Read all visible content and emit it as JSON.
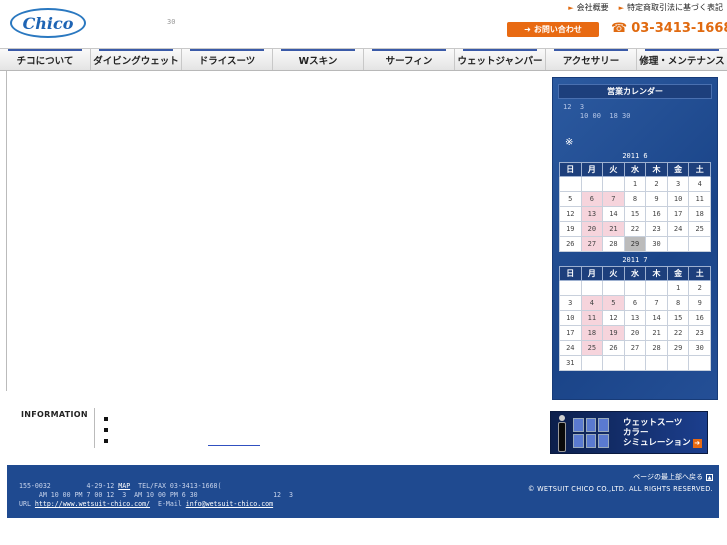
{
  "header": {
    "logo_text": "Chico",
    "logo_tagline": "30",
    "links": [
      {
        "label": "会社概要"
      },
      {
        "label": "特定商取引法に基づく表記"
      }
    ],
    "contact_label": "お問い合わせ",
    "phone": "03-3413-1668"
  },
  "nav": {
    "items": [
      {
        "label": "チコについて"
      },
      {
        "label": "ダイビングウェット"
      },
      {
        "label": "ドライスーツ"
      },
      {
        "label": "Wスキン"
      },
      {
        "label": "サーフィン"
      },
      {
        "label": "ウェットジャンパー"
      },
      {
        "label": "アクセサリー"
      },
      {
        "label": "修理・メンテナンス"
      }
    ]
  },
  "sidebar": {
    "title": "営業カレンダー",
    "note_line1": "12  3",
    "note_line2": "    10 00  18 30",
    "star": "※",
    "weekdays": [
      "日",
      "月",
      "火",
      "水",
      "木",
      "金",
      "土"
    ],
    "calendars": [
      {
        "title": "2011  6",
        "weeks": [
          [
            "",
            "",
            "",
            "1",
            "2",
            "3",
            "4"
          ],
          [
            "5",
            "6",
            "7",
            "8",
            "9",
            "10",
            "11"
          ],
          [
            "12",
            "13",
            "14",
            "15",
            "16",
            "17",
            "18"
          ],
          [
            "19",
            "20",
            "21",
            "22",
            "23",
            "24",
            "25"
          ],
          [
            "26",
            "27",
            "28",
            "29",
            "30",
            "",
            ""
          ]
        ],
        "holidays": [
          "6",
          "7",
          "13",
          "20",
          "21",
          "27"
        ],
        "today": "29"
      },
      {
        "title": "2011  7",
        "weeks": [
          [
            "",
            "",
            "",
            "",
            "",
            "1",
            "2"
          ],
          [
            "3",
            "4",
            "5",
            "6",
            "7",
            "8",
            "9"
          ],
          [
            "10",
            "11",
            "12",
            "13",
            "14",
            "15",
            "16"
          ],
          [
            "17",
            "18",
            "19",
            "20",
            "21",
            "22",
            "23"
          ],
          [
            "24",
            "25",
            "26",
            "27",
            "28",
            "29",
            "30"
          ],
          [
            "31",
            "",
            "",
            "",
            "",
            "",
            ""
          ]
        ],
        "holidays": [
          "4",
          "5",
          "11",
          "18",
          "19",
          "25"
        ],
        "today": ""
      }
    ]
  },
  "info": {
    "label": "INFORMATION",
    "items": [
      {
        "text": ""
      },
      {
        "text": ""
      },
      {
        "text": ""
      }
    ]
  },
  "banner": {
    "line1": "ウェットスーツ",
    "line2": "カラー",
    "line3": "シミュレーション"
  },
  "footer": {
    "address": "155-0032         4-29-12",
    "map_link": "MAP",
    "tel": "  TEL/FAX 03-3413-1668(",
    "hours": "     AM 10 00 PM 7 00 12  3  AM 10 00 PM 6 30                   12  3",
    "url_label": "URL",
    "url": "http://www.wetsuit-chico.com/",
    "email_label": "  E-Mail ",
    "email": "info@wetsuit-chico.com",
    "back_to_top": "ページの最上部へ戻る",
    "copyright": "© WETSUIT CHICO CO.,LTD. ALL RIGHTS RESERVED."
  }
}
